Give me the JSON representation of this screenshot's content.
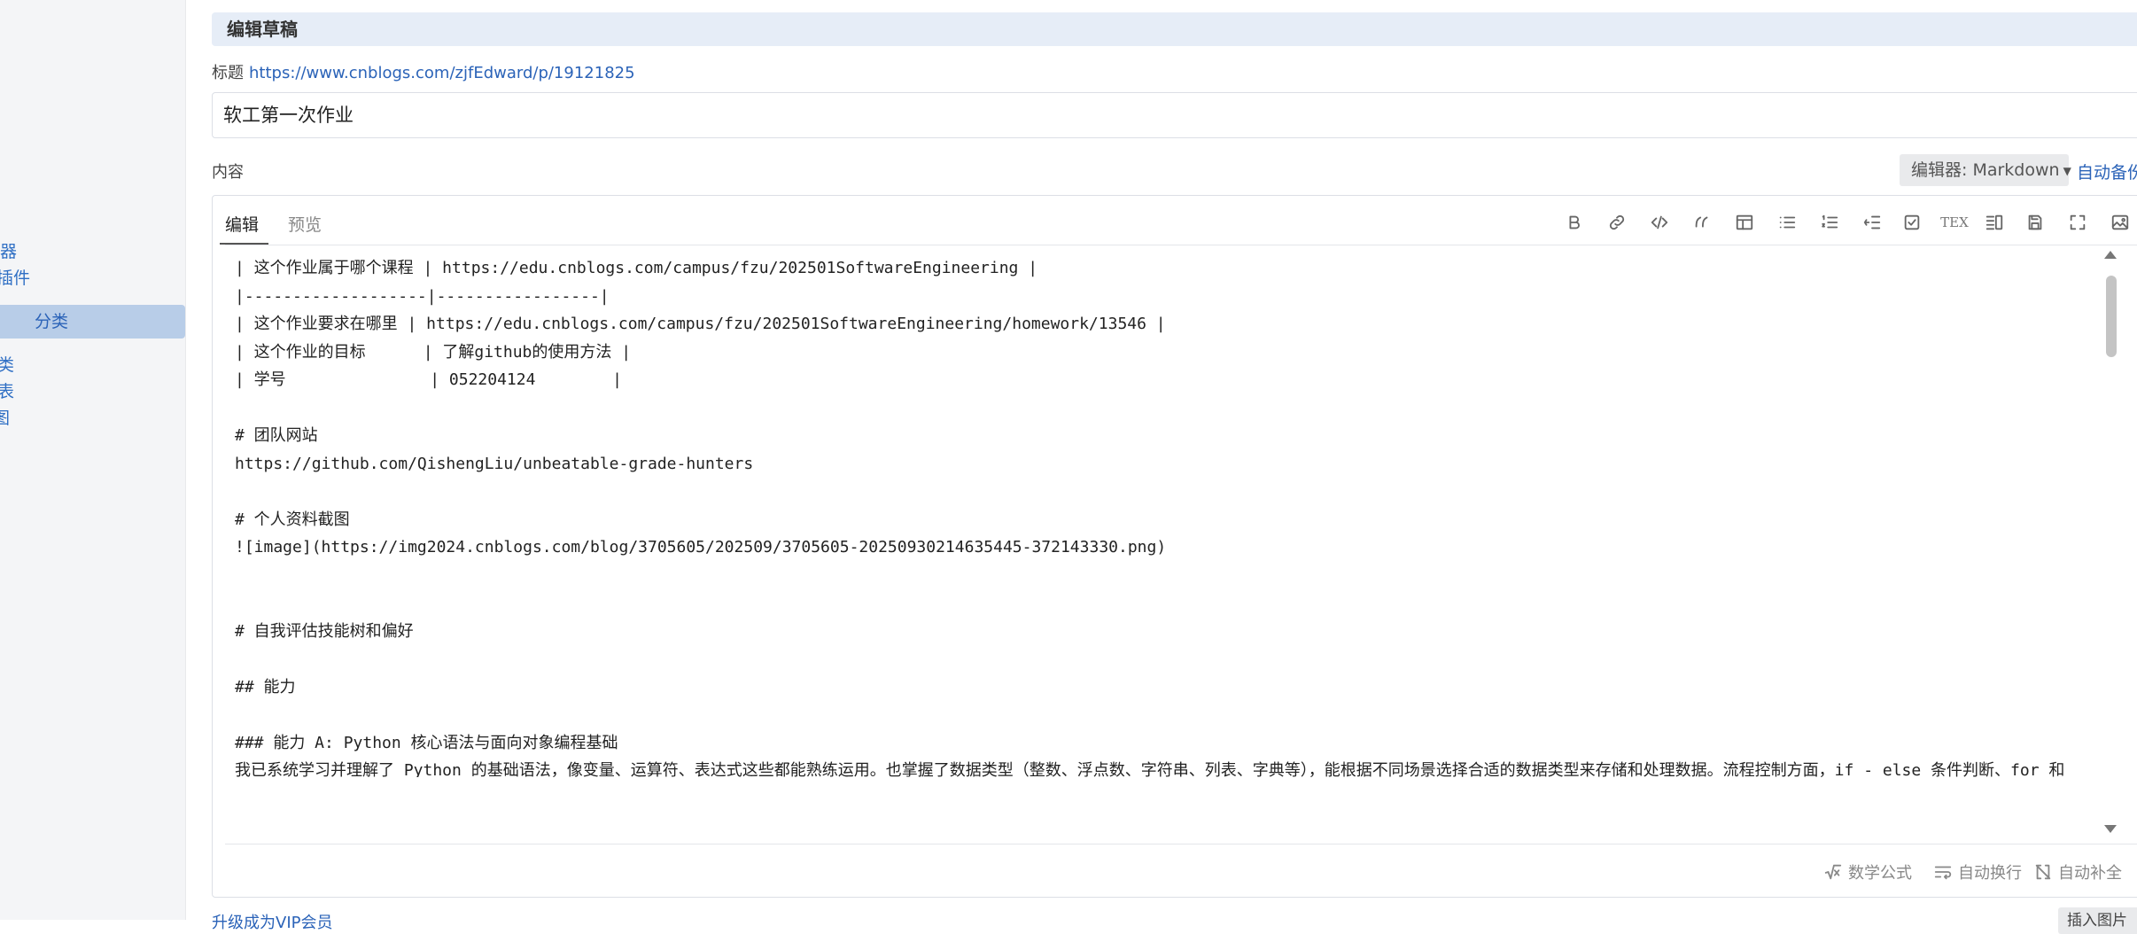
{
  "sidebar": {
    "items": [
      {
        "label": "器"
      },
      {
        "label": "插件"
      },
      {
        "label": "分类"
      },
      {
        "label": "类"
      },
      {
        "label": "表"
      },
      {
        "label": "图"
      }
    ]
  },
  "section_header": "编辑草稿",
  "title_field": {
    "label": "标题",
    "link": "https://www.cnblogs.com/zjfEdward/p/19121825",
    "value": "软工第一次作业"
  },
  "content_label": "内容",
  "editor_select": "编辑器: Markdown",
  "autobackup": "自动备份",
  "tabs": {
    "edit": "编辑",
    "preview": "预览"
  },
  "toolbar": [
    {
      "icon": "bold-icon"
    },
    {
      "icon": "link-icon"
    },
    {
      "icon": "code-icon"
    },
    {
      "icon": "quote-icon"
    },
    {
      "icon": "table-icon"
    },
    {
      "icon": "bullet-list-icon"
    },
    {
      "icon": "numbered-list-icon"
    },
    {
      "icon": "outdent-icon"
    },
    {
      "icon": "checkbox-icon"
    },
    {
      "icon": "tex-icon",
      "label": "TEX"
    },
    {
      "icon": "side-preview-icon"
    },
    {
      "icon": "save-icon"
    },
    {
      "icon": "fullscreen-icon"
    },
    {
      "icon": "image-icon"
    }
  ],
  "code_lines": [
    "| 这个作业属于哪个课程 | https://edu.cnblogs.com/campus/fzu/202501SoftwareEngineering |",
    "|-------------------|-----------------|",
    "| 这个作业要求在哪里 | https://edu.cnblogs.com/campus/fzu/202501SoftwareEngineering/homework/13546 |",
    "| 这个作业的目标      | 了解github的使用方法 |",
    "| 学号               | 052204124        |",
    "",
    "# 团队网站",
    "https://github.com/QishengLiu/unbeatable-grade-hunters",
    "",
    "# 个人资料截图",
    "![image](https://img2024.cnblogs.com/blog/3705605/202509/3705605-20250930214635445-372143330.png)",
    "",
    "",
    "# 自我评估技能树和偏好",
    "",
    "## 能力",
    "",
    "### 能力 A: Python 核心语法与面向对象编程基础",
    "我已系统学习并理解了 Python 的基础语法，像变量、运算符、表达式这些都能熟练运用。也掌握了数据类型（整数、浮点数、字符串、列表、字典等），能根据不同场景选择合适的数据类型来存储和处理数据。流程控制方面，if - else 条件判断、for 和 while 循环都能灵活使用，来控制程序的执行流程。"
  ],
  "bottom_bar": {
    "math": "数学公式",
    "wrap": "自动换行",
    "complete": "自动补全"
  },
  "footer": {
    "link": "升级成为VIP会员",
    "button": "插入图片"
  }
}
